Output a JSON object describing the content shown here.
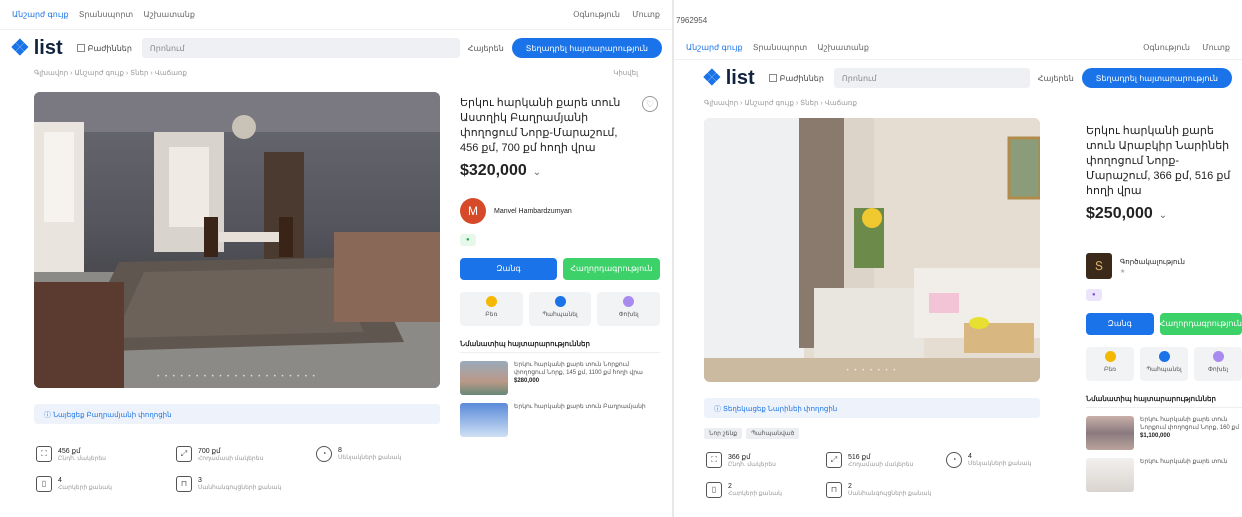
{
  "listing_a": {
    "title": "Երկու հարկանի քարե տուն Աստղիկ Բաղրամյանի փողոցում Նորք-Մարաշում, 456 քմ, 700 քմ հողի վրա",
    "price": "$320,000",
    "seller_initial": "M",
    "seller_name": "Manvel Hambardzumyan",
    "buttons": {
      "call": "Զանգ",
      "message": "Հաղորդագրություն"
    },
    "actions": [
      "Բեռ",
      "Պահպանել",
      "Փոխել"
    ],
    "notice": "Նայեցեք Բաղրամյանի փողոցին",
    "similar_header": "Նմանատիպ հայտարարություններ",
    "similar": [
      {
        "text": "Երկու հարկանի քարե տուն Նորքում փողոցում Նորք, 145 քմ, 1100 քմ հողի վրա",
        "price": "$280,000"
      },
      {
        "text": "Երկու հարկանի քարե տուն Բաղրամյանի"
      }
    ],
    "specs": [
      {
        "icon": "area-icon",
        "value": "456 քմ",
        "label": "Ընդհ. մակերես"
      },
      {
        "icon": "land-icon",
        "value": "700 քմ",
        "label": "Հողամասի մակերես"
      },
      {
        "icon": "rooms-icon",
        "value": "8",
        "label": "Սենյակների քանակ"
      },
      {
        "icon": "floors-icon",
        "value": "4",
        "label": "Հարկերի քանակ"
      },
      {
        "icon": "bath-icon",
        "value": "3",
        "label": "Սանհանգույցների քանակ"
      }
    ]
  },
  "listing_b": {
    "url_fragment": "7962954",
    "title": "Երկու հարկանի քարե տուն Արաբկիր Նարինեի փողոցում Նորք-Մարաշում, 366 քմ, 516 քմ հողի վրա",
    "price": "$250,000",
    "seller_initial": "Տ",
    "seller_name": "Գործակալություն",
    "buttons": {
      "call": "Զանգ",
      "message": "Հաղորդագրություն"
    },
    "actions": [
      "Բեռ",
      "Պահպանել",
      "Փոխել"
    ],
    "notice": "Տեղեկացեք Նարինեի փողոցին",
    "tags": [
      "Նոր շենք",
      "Պահպանված"
    ],
    "similar_header": "Նմանատիպ հայտարարություններ",
    "similar": [
      {
        "text": "Երկու հարկանի քարե տուն Նորքում փողոցում Նորք, 160 քմ",
        "price": "$1,100,000"
      },
      {
        "text": "Երկու հարկանի քարե տուն"
      }
    ],
    "specs": [
      {
        "icon": "area-icon",
        "value": "366 քմ",
        "label": "Ընդհ. մակերես"
      },
      {
        "icon": "land-icon",
        "value": "516 քմ",
        "label": "Հողամասի մակերես"
      },
      {
        "icon": "rooms-icon",
        "value": "4",
        "label": "Սենյակների քանակ"
      },
      {
        "icon": "floors-icon",
        "value": "2",
        "label": "Հարկերի քանակ"
      },
      {
        "icon": "bath-icon",
        "value": "2",
        "label": "Սանհանգույցների քանակ"
      }
    ]
  },
  "site": {
    "top_links": [
      "Անշարժ գույք",
      "Տրանսպորտ",
      "Աշխատանք"
    ],
    "top_right": [
      "Օգնություն",
      "Մուտք"
    ],
    "logo_text": "list",
    "category": "Բաժիններ",
    "search_placeholder": "Որոնում",
    "lang": "Հայերեն",
    "post_button": "Տեղադրել հայտարարություն",
    "breadcrumbs": "Գլխավոր › Անշարժ գույք › Տներ › Վաճառք",
    "share": "Կիսվել",
    "accent_color": "#1a73e8"
  }
}
